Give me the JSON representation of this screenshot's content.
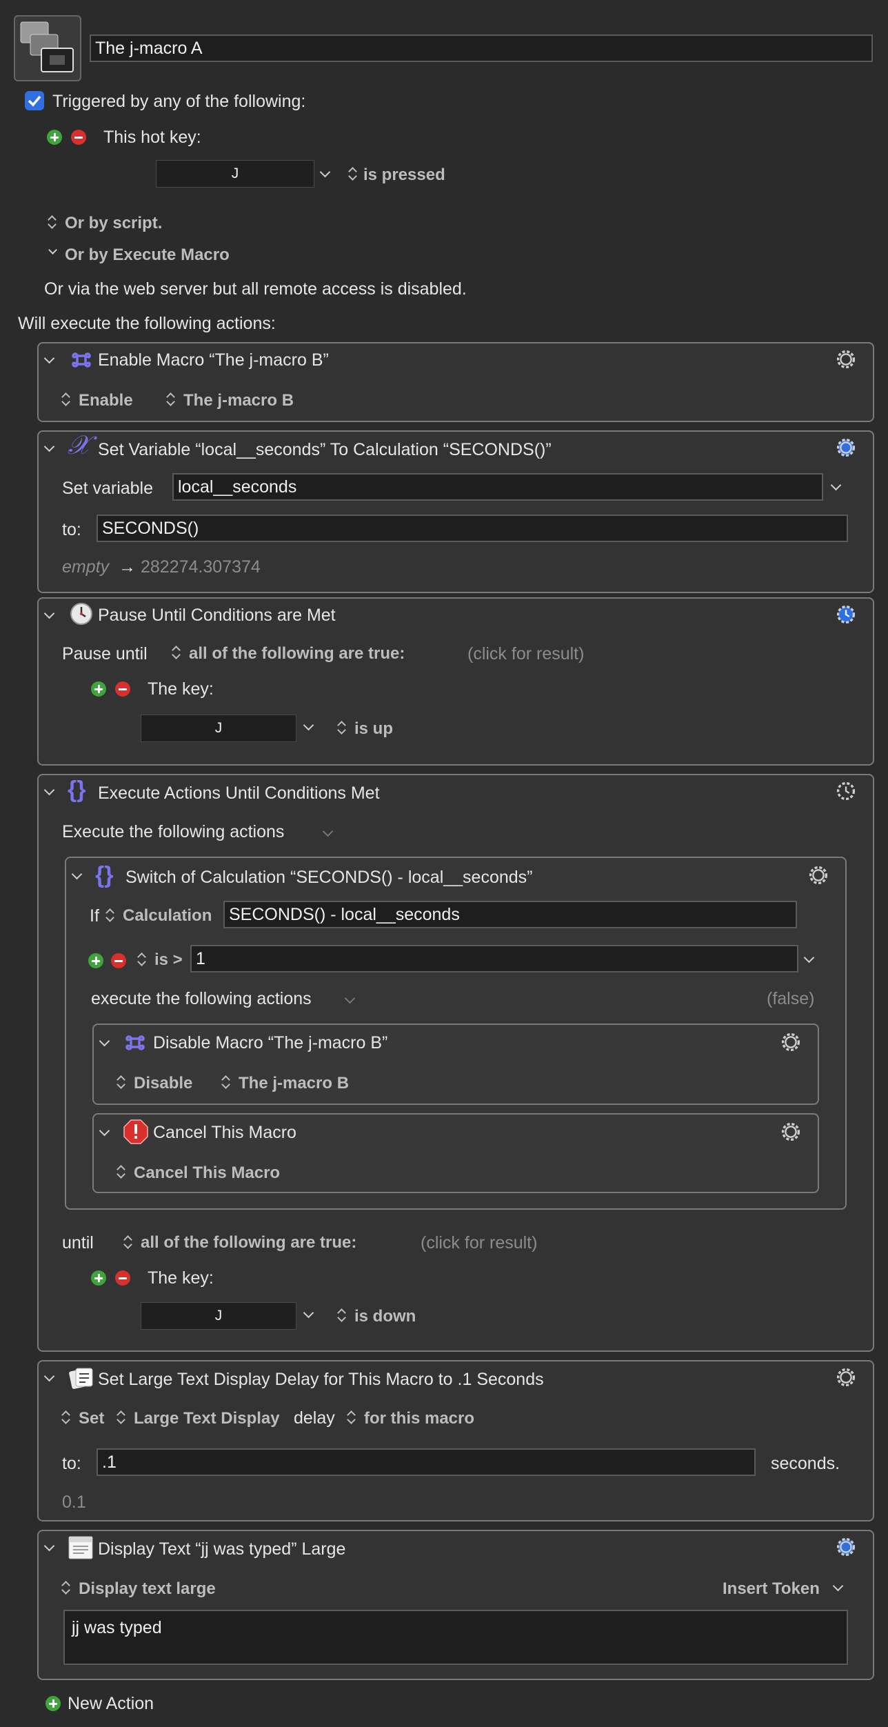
{
  "macro": {
    "name": "The j-macro A"
  },
  "colors": {
    "background": "#2b2b2b",
    "card_border": "#7a7a7a",
    "accent_blue": "#2f6fe0",
    "icon_purple": "#7b74ee",
    "add_green": "#3fa53a",
    "remove_red": "#d9302c"
  },
  "trigger": {
    "checkbox_label": "Triggered by any of the following:",
    "checked": true,
    "hotkey_label": "This hot key:",
    "hotkey_value": "J",
    "hotkey_state": "is pressed",
    "by_script": "Or by script.",
    "by_execute": "Or by Execute Macro",
    "web_server": "Or via the web server but all remote access is disabled."
  },
  "actions_heading": "Will execute the following actions:",
  "actions": {
    "enable": {
      "title": "Enable Macro “The j-macro B”",
      "icon": "command-icon",
      "mode": "Enable",
      "target": "The j-macro B"
    },
    "set_variable": {
      "title": "Set Variable “local__seconds” To Calculation “SECONDS()”",
      "icon": "variable-x-icon",
      "label_var": "Set variable",
      "variable": "local__seconds",
      "label_to": "to:",
      "value": "SECONDS()",
      "result_empty": "empty",
      "result_arrow": "→",
      "result": "282274.307374"
    },
    "pause": {
      "title": "Pause Until Conditions are Met",
      "icon": "clock-icon",
      "label": "Pause until",
      "condition": "all of the following are true:",
      "click_result": "(click for result)",
      "key_label": "The key:",
      "key": "J",
      "key_state": "is up"
    },
    "execute_until": {
      "title": "Execute Actions Until Conditions Met",
      "icon": "braces-icon",
      "label": "Execute the following actions",
      "switch": {
        "title": "Switch of Calculation “SECONDS() - local__seconds”",
        "icon": "braces-icon",
        "if_label": "If",
        "type": "Calculation",
        "expression": "SECONDS() - local__seconds",
        "operator": "is >",
        "compare_value": "1",
        "execute_label": "execute the following actions",
        "false_label": "(false)",
        "disable": {
          "title": "Disable Macro “The j-macro B”",
          "icon": "command-icon",
          "mode": "Disable",
          "target": "The j-macro B"
        },
        "cancel": {
          "title": "Cancel This Macro",
          "icon": "stop-alert-icon",
          "mode": "Cancel This Macro"
        }
      },
      "until_label": "until",
      "until_condition": "all of the following are true:",
      "click_result": "(click for result)",
      "key_label": "The key:",
      "key": "J",
      "key_state": "is down"
    },
    "large_text_delay": {
      "title": "Set Large Text Display Delay for This Macro to .1 Seconds",
      "icon": "delay-card-icon",
      "set": "Set",
      "target": "Large Text Display",
      "delay_word": "delay",
      "scope": "for this macro",
      "label_to": "to:",
      "value": ".1",
      "unit": "seconds.",
      "result": "0.1"
    },
    "display_text": {
      "title": "Display Text “jj was typed” Large",
      "icon": "window-icon",
      "mode": "Display text large",
      "insert_token": "Insert Token",
      "text": "jj was typed"
    }
  },
  "new_action": "New Action"
}
